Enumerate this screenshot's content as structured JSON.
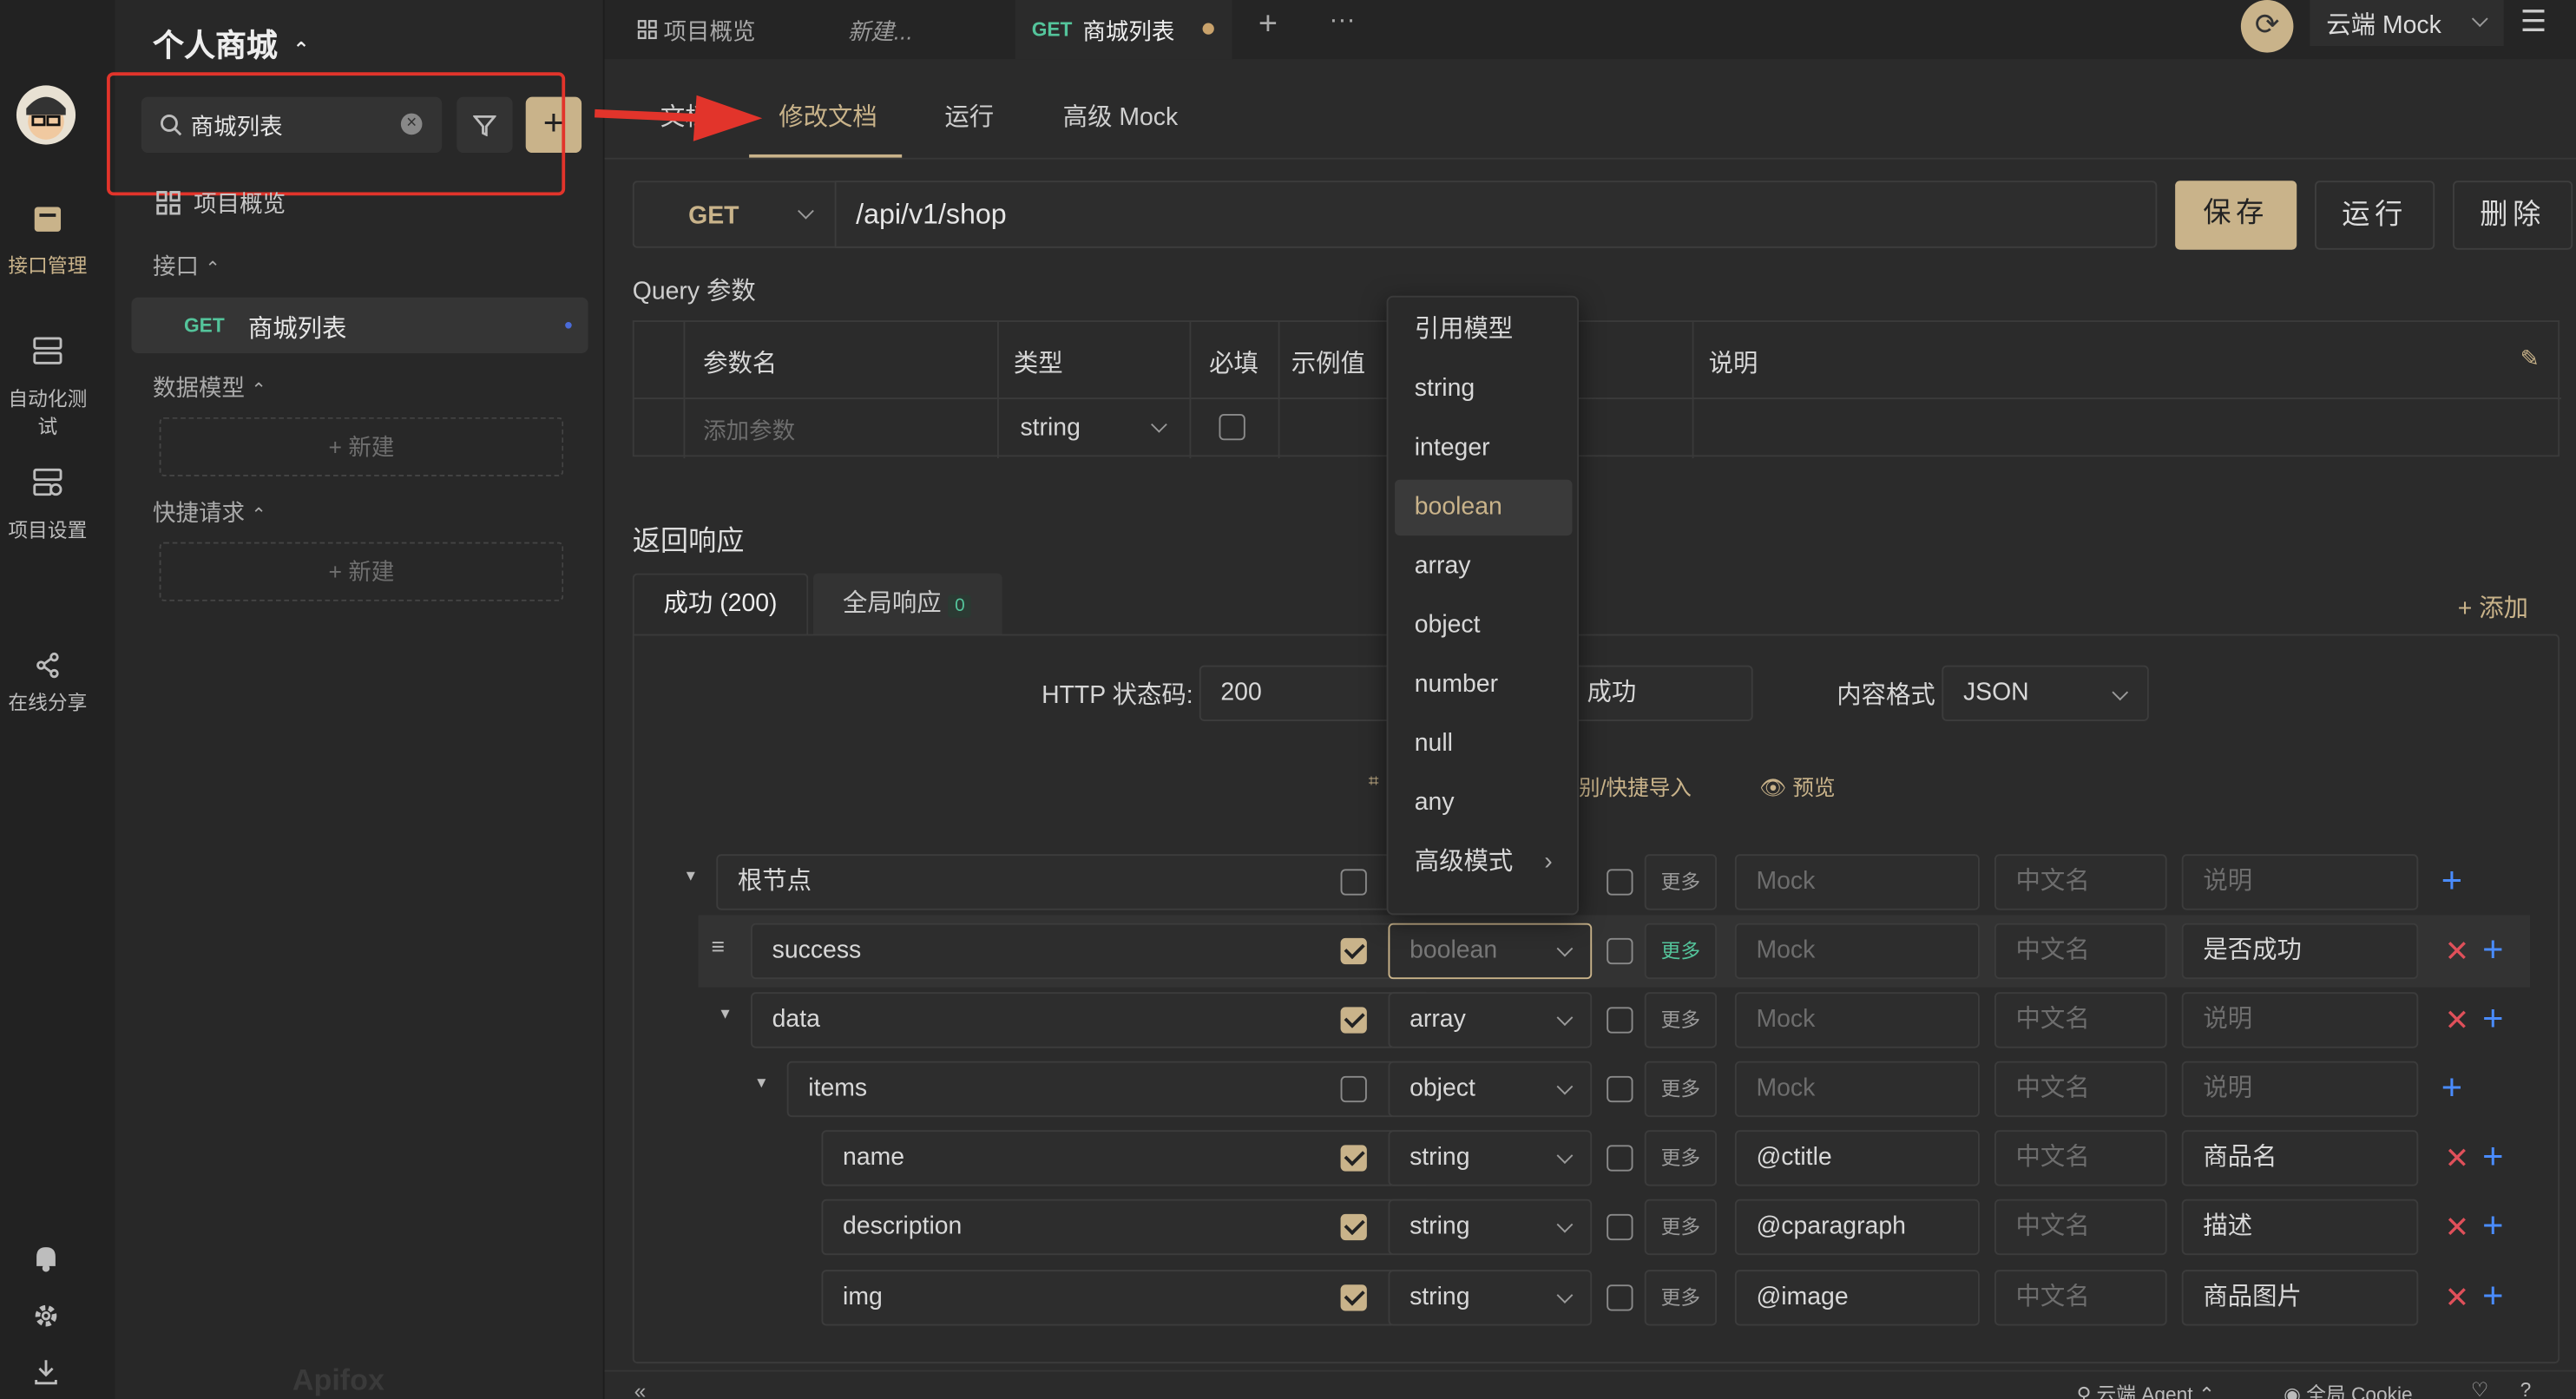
{
  "project": {
    "name": "个人商城"
  },
  "rail": {
    "items": [
      "接口管理",
      "自动化测试",
      "项目设置",
      "在线分享"
    ]
  },
  "sidebar": {
    "search_value": "商城列表",
    "overview": "项目概览",
    "api_section": "接口",
    "api_method": "GET",
    "api_name": "商城列表",
    "models_section": "数据模型",
    "new_label": "新建",
    "quick_section": "快捷请求",
    "watermark": "Apifox"
  },
  "topbar": {
    "tab_overview": "项目概览",
    "tab_new": "新建...",
    "tab_method": "GET",
    "tab_active": "商城列表",
    "env": "云端 Mock"
  },
  "subtabs": [
    "文档",
    "修改文档",
    "运行",
    "高级 Mock"
  ],
  "request": {
    "method": "GET",
    "url": "/api/v1/shop",
    "save": "保存",
    "run": "运行",
    "delete": "删除"
  },
  "query": {
    "title": "Query 参数",
    "headers": [
      "参数名",
      "类型",
      "必填",
      "示例值",
      "说明"
    ],
    "add_placeholder": "添加参数",
    "type_value": "string"
  },
  "response": {
    "title": "返回响应",
    "tab_success": "成功 (200)",
    "tab_global": "全局响应",
    "global_count": "0",
    "add": "添加",
    "status_label": "HTTP 状态码:",
    "status_value": "200",
    "name_value_tail": "成功",
    "format_label": "内容格式",
    "format_value": "JSON",
    "import_tail": "别/快捷导入",
    "preview": "预览"
  },
  "dropdown": {
    "items": [
      "引用模型",
      "string",
      "integer",
      "boolean",
      "array",
      "object",
      "number",
      "null",
      "any",
      "高级模式"
    ],
    "selected": "boolean"
  },
  "schema": {
    "more": "更多",
    "mock_ph": "Mock",
    "cn_ph": "中文名",
    "desc_ph": "说明",
    "rows": [
      {
        "name": "根节点",
        "type": "",
        "mock": "",
        "desc": ""
      },
      {
        "name": "success",
        "type": "boolean",
        "mock": "",
        "desc": "是否成功"
      },
      {
        "name": "data",
        "type": "array",
        "mock": "",
        "desc": ""
      },
      {
        "name": "items",
        "type": "object",
        "mock": "",
        "desc": ""
      },
      {
        "name": "name",
        "type": "string",
        "mock": "@ctitle",
        "desc": "商品名"
      },
      {
        "name": "description",
        "type": "string",
        "mock": "@cparagraph",
        "desc": "描述"
      },
      {
        "name": "img",
        "type": "string",
        "mock": "@image",
        "desc": "商品图片"
      }
    ]
  },
  "footer": {
    "agent": "云端 Agent",
    "cookie": "全局 Cookie"
  },
  "colors": {
    "accent": "#c9b38a",
    "get": "#54c49b",
    "annotation": "#e2342b",
    "blue": "#4a8cff",
    "danger": "#e0505a"
  }
}
